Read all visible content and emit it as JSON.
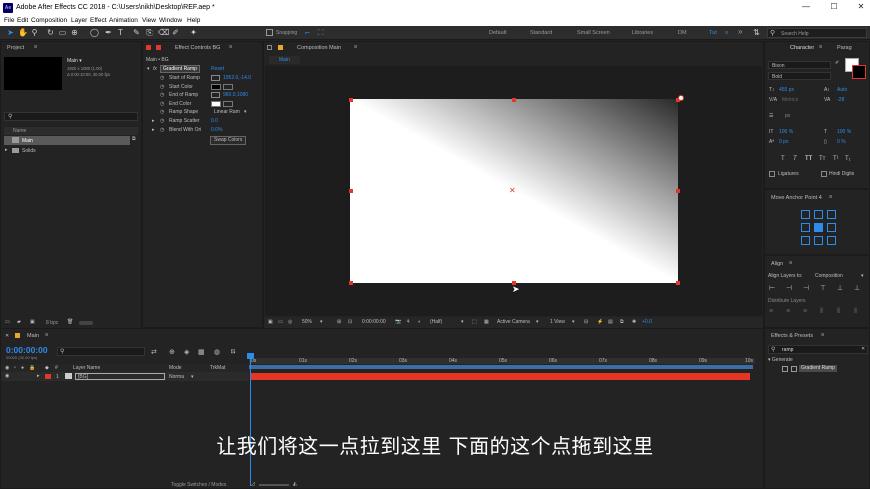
{
  "window": {
    "title": "Adobe After Effects CC 2018 - C:\\Users\\nikh\\Desktop\\REF.aep *",
    "logo": "Ae",
    "min": "—",
    "max": "☐",
    "close": "✕"
  },
  "menu": [
    "File",
    "Edit",
    "Composition",
    "Layer",
    "Effect",
    "Animation",
    "View",
    "Window",
    "Help"
  ],
  "toolbar": {
    "snapping": "Snapping",
    "workspaces": [
      "Default",
      "Standard",
      "Small Screen",
      "Libraries",
      "DM",
      "Tut"
    ],
    "more": "»",
    "search_placeholder": "Search Help"
  },
  "project": {
    "tab": "Project",
    "item_name": "Main ▾",
    "item_size": "1920 x 1080 (1.00)",
    "item_duration": "Δ 0:00:10:00, 30.00 fps",
    "col_name": "Name",
    "items": [
      "Main",
      "Solids"
    ],
    "bpc": "8 bpc"
  },
  "effect_controls": {
    "tab": "Effect Controls BG",
    "layer": "Main • BG",
    "effect_name": "Gradient Ramp",
    "reset": "Reset",
    "fx": "fx",
    "props": [
      {
        "label": "Start of Ramp",
        "value": "1952.0,-14.0"
      },
      {
        "label": "Start Color",
        "value": ""
      },
      {
        "label": "End of Ramp",
        "value": "960.0,1080"
      },
      {
        "label": "End Color",
        "value": ""
      },
      {
        "label": "Ramp Shape",
        "value": "Linear Ram"
      },
      {
        "label": "Ramp Scatter",
        "value": "0.0"
      },
      {
        "label": "Blend With Ori",
        "value": "0.0%"
      }
    ],
    "swap": "Swap Colors"
  },
  "composition": {
    "tab": "Composition Main",
    "subtab": "Main",
    "zoom": "50%",
    "timecode": "0:00:00:00",
    "resolution": "(Half)",
    "camera": "Active Camera",
    "views": "1 View",
    "exposure": "+0.0"
  },
  "character": {
    "tab": "Character",
    "tab2": "Parag",
    "font": "Bison",
    "style": "Bold",
    "size": "455 px",
    "leading": "Auto",
    "kerning": "Metrics",
    "tracking": "-28",
    "stroke": "px",
    "vscale": "100 %",
    "hscale": "100 %",
    "baseline": "0 px",
    "tsume": "0 %",
    "styles": [
      "T",
      "T",
      "TT",
      "Tт",
      "T¹",
      "T₁"
    ],
    "ligatures": "Ligatures",
    "hindi": "Hindi Digits"
  },
  "anchor": {
    "tab": "Move Anchor Point 4"
  },
  "align": {
    "tab": "Align",
    "align_to_label": "Align Layers to:",
    "align_to": "Composition",
    "distribute": "Distribute Layers"
  },
  "effects_presets": {
    "tab": "Effects & Presets",
    "search": "ramp",
    "category": "Generate",
    "item": "Gradient Ramp"
  },
  "timeline": {
    "tab": "Main",
    "timecode": "0:00:00:00",
    "fps": "00000 (30.00 fps)",
    "cols": {
      "layer_name": "Layer Name",
      "mode": "Mode",
      "trkmat": "TrkMat"
    },
    "layer": {
      "num": "1",
      "name": "[BG]",
      "mode": "Norma"
    },
    "ticks": [
      "0s",
      "01s",
      "02s",
      "03s",
      "04s",
      "05s",
      "06s",
      "07s",
      "08s",
      "09s",
      "10s"
    ],
    "toggle": "Toggle Switches / Modes"
  },
  "subtitle": "让我们将这一点拉到这里 下面的这个点拖到这里",
  "colors": {
    "accent": "#2d8ceb",
    "handle": "#e0392b",
    "layer_bar": "#e53623"
  }
}
